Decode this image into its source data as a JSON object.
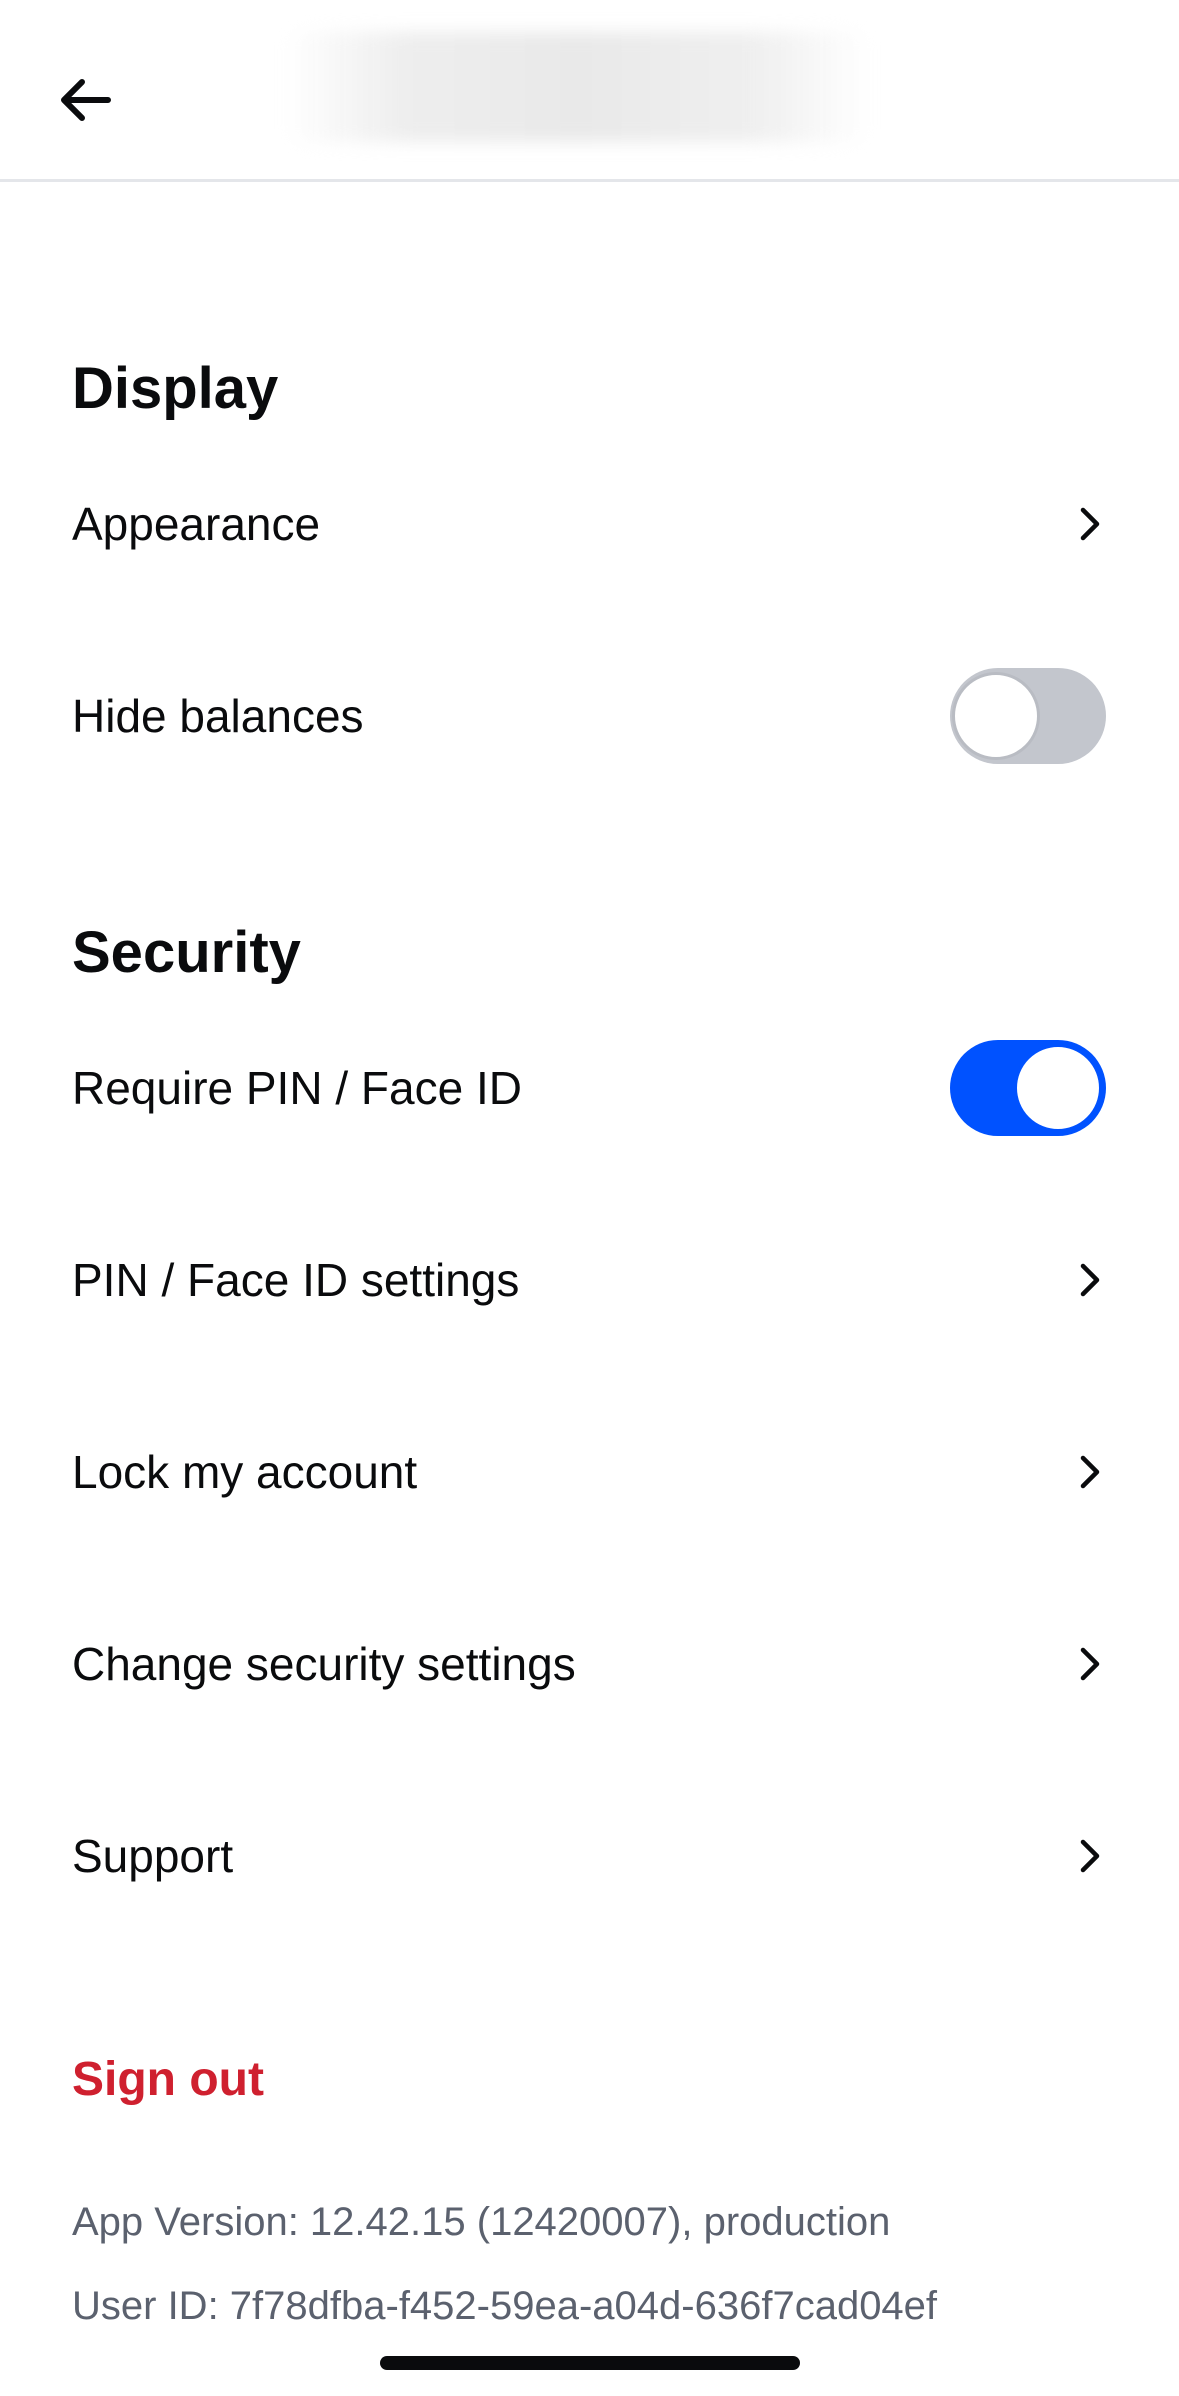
{
  "sections": {
    "display": {
      "title": "Display",
      "appearance_label": "Appearance",
      "hide_balances_label": "Hide balances",
      "hide_balances_on": false
    },
    "security": {
      "title": "Security",
      "require_pin_label": "Require PIN / Face ID",
      "require_pin_on": true,
      "pin_settings_label": "PIN / Face ID settings",
      "lock_account_label": "Lock my account",
      "change_security_label": "Change security settings",
      "support_label": "Support"
    }
  },
  "sign_out_label": "Sign out",
  "app_version": "App Version: 12.42.15 (12420007), production",
  "user_id": "User ID: 7f78dfba-f452-59ea-a04d-636f7cad04ef",
  "colors": {
    "accent": "#0052ff",
    "danger": "#cf202f",
    "toggle_off": "#c3c6cd",
    "muted_text": "#5b616e"
  },
  "icons": {
    "back": "arrow-left-icon",
    "chevron": "chevron-right-icon"
  }
}
